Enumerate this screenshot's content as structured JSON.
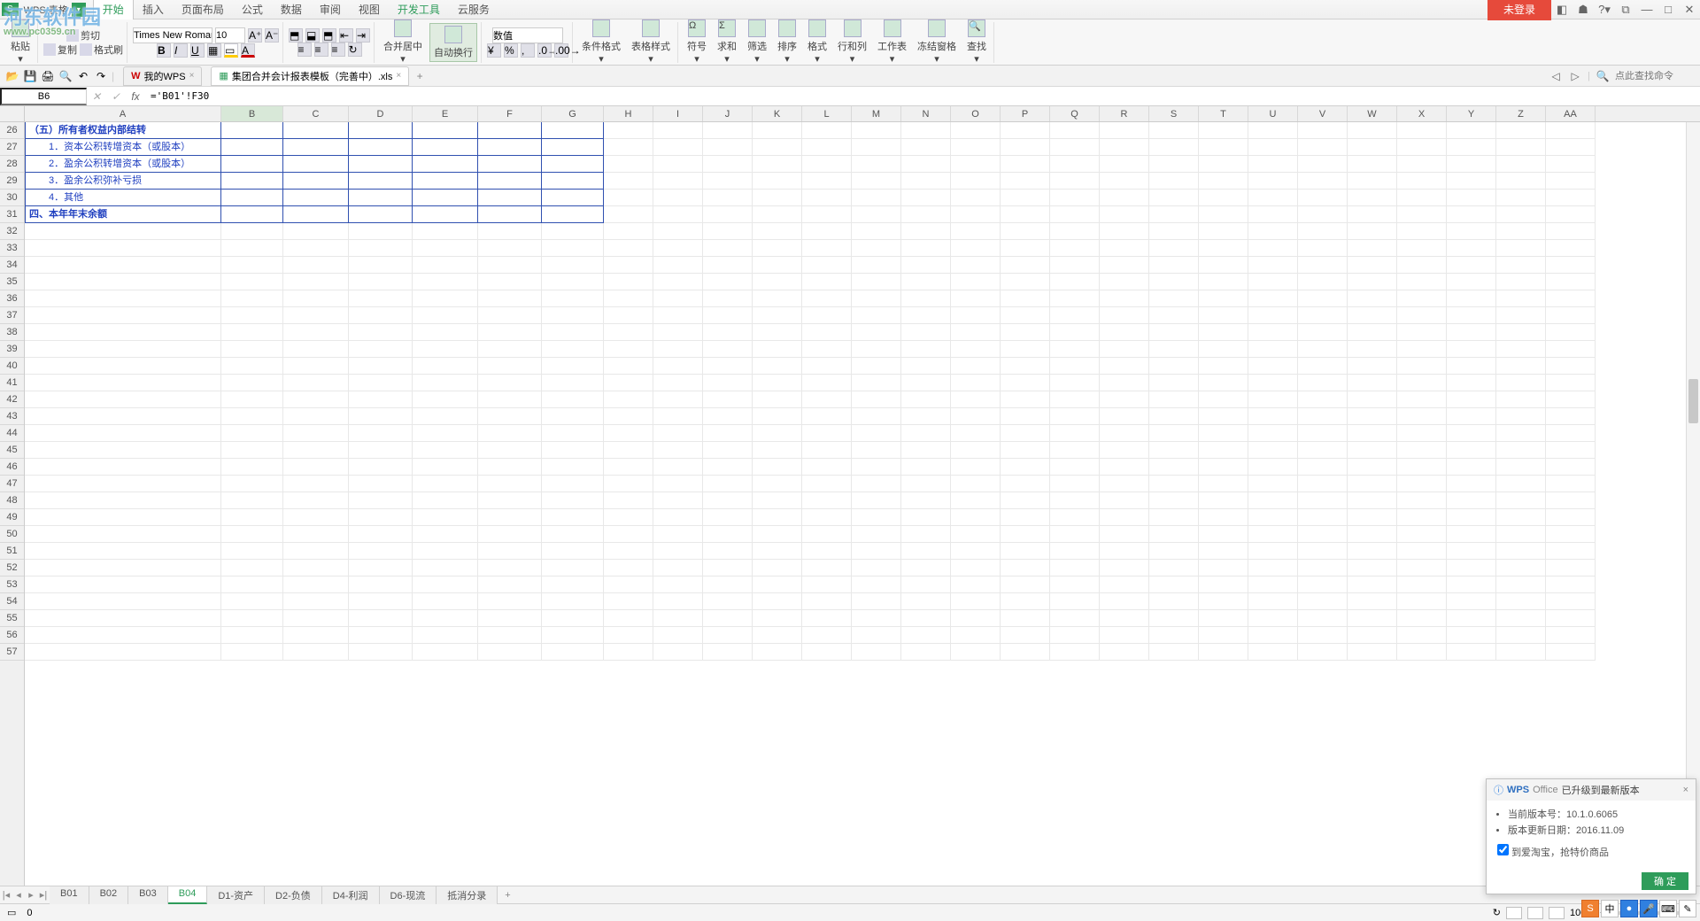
{
  "app": {
    "badge": "S",
    "name": "WPS 表格",
    "login": "未登录"
  },
  "watermark": {
    "main": "河东软件园",
    "sub": "www.pc0359.cn"
  },
  "ribbon_tabs": [
    "开始",
    "插入",
    "页面布局",
    "公式",
    "数据",
    "审阅",
    "视图",
    "开发工具",
    "云服务"
  ],
  "ribbon_active": 0,
  "ribbon_green": [
    0,
    7
  ],
  "ribbon": {
    "paste": "粘贴",
    "cut": "剪切",
    "copy": "复制",
    "format_painter": "格式刷",
    "font": "Times New Roman",
    "font_size": "10",
    "merge": "合并居中",
    "wrap": "自动换行",
    "number_format": "数值",
    "cond_fmt": "条件格式",
    "table_style": "表格样式",
    "symbol": "符号",
    "sum": "求和",
    "filter": "筛选",
    "sort": "排序",
    "format": "格式",
    "rowcol": "行和列",
    "worksheet": "工作表",
    "freeze": "冻结窗格",
    "find": "查找"
  },
  "qa": {
    "my_wps": "我的WPS",
    "doc_name": "集团合并会计报表模板（完善中）.xls",
    "search_placeholder": "点此查找命令"
  },
  "formula": {
    "name_box": "B6",
    "value": "='B01'!F30"
  },
  "columns": [
    "A",
    "B",
    "C",
    "D",
    "E",
    "F",
    "G",
    "H",
    "I",
    "J",
    "K",
    "L",
    "M",
    "N",
    "O",
    "P",
    "Q",
    "R",
    "S",
    "T",
    "U",
    "V",
    "W",
    "X",
    "Y",
    "Z",
    "AA"
  ],
  "col_widths": {
    "A": 222,
    "B": 70,
    "C": 74,
    "D": 72,
    "E": 74,
    "F": 72,
    "G": 70
  },
  "selected_col": "B",
  "row_start": 26,
  "row_end": 57,
  "data_rows": [
    {
      "r": 26,
      "a": "（五）所有者权益内部结转",
      "bold": true
    },
    {
      "r": 27,
      "a": "　　1．资本公积转增资本（或股本）"
    },
    {
      "r": 28,
      "a": "　　2．盈余公积转增资本（或股本）"
    },
    {
      "r": 29,
      "a": "　　3．盈余公积弥补亏损"
    },
    {
      "r": 30,
      "a": "　　4．其他"
    },
    {
      "r": 31,
      "a": "四、本年年末余额",
      "bold": true
    }
  ],
  "boxed_last_row": 31,
  "boxed_cols": [
    "A",
    "B",
    "C",
    "D",
    "E",
    "F",
    "G"
  ],
  "sheet_tabs": [
    "B01",
    "B02",
    "B03",
    "B04",
    "D1-资产",
    "D2-负债",
    "D4-利润",
    "D6-现流",
    "抵消分录"
  ],
  "sheet_active": "B04",
  "status": {
    "sum": "0",
    "zoom": "100%"
  },
  "notify": {
    "title_prefix": "WPS",
    "title_suffix": "Office",
    "title_rest": "已升级到最新版本",
    "version_label": "当前版本号：",
    "version": "10.1.0.6065",
    "date_label": "版本更新日期：",
    "date": "2016.11.09",
    "checkbox": "到爱淘宝，抢特价商品",
    "ok": "确 定"
  },
  "ime": [
    "S",
    "中",
    ",",
    "·",
    "❖",
    "⌨",
    "✎"
  ]
}
